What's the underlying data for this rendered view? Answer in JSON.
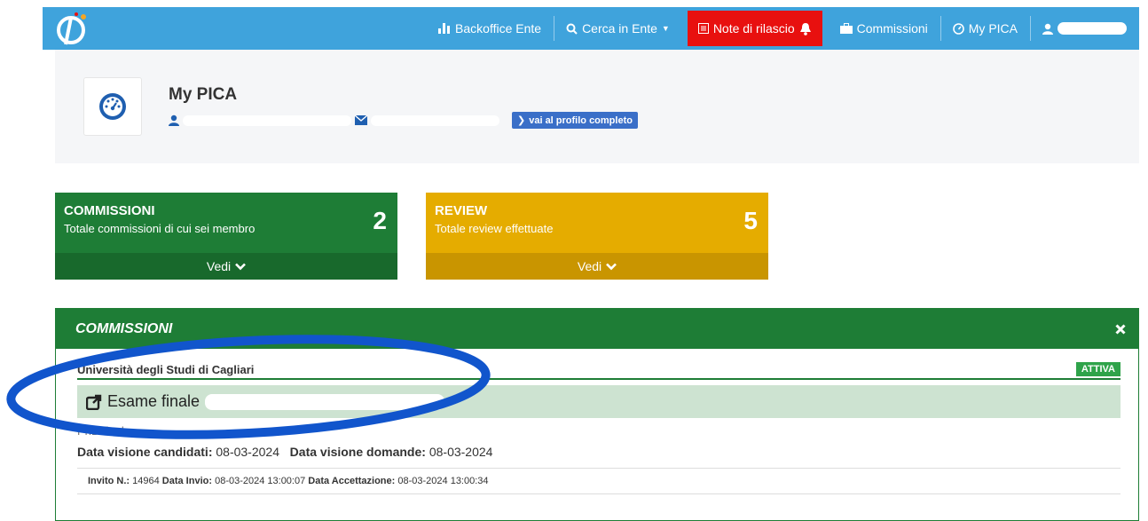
{
  "navbar": {
    "backoffice": "Backoffice Ente",
    "search": "Cerca in Ente",
    "release_notes": "Note di rilascio",
    "commissions": "Commissioni",
    "my_pica": "My PICA"
  },
  "profile": {
    "title": "My PICA",
    "full_profile_link": "vai al profilo completo"
  },
  "cards": [
    {
      "title": "COMMISSIONI",
      "subtitle": "Totale commissioni di cui sei membro",
      "count": "2",
      "action": "Vedi"
    },
    {
      "title": "REVIEW",
      "subtitle": "Totale review effettuate",
      "count": "5",
      "action": "Vedi"
    }
  ],
  "panel": {
    "title": "COMMISSIONI",
    "university": "Università degli Studi di Cagliari",
    "status": "ATTIVA",
    "exam_title": "Esame finale",
    "phd_line": "PhD final",
    "dates": {
      "candidates_label": "Data visione candidati:",
      "candidates_value": "08-03-2024",
      "applications_label": "Data visione domande:",
      "applications_value": "08-03-2024"
    },
    "invite": {
      "number_label": "Invito N.:",
      "number_value": "14964",
      "sent_label": "Data Invio:",
      "sent_value": "08-03-2024 13:00:07",
      "accepted_label": "Data Accettazione:",
      "accepted_value": "08-03-2024 13:00:34"
    }
  },
  "colors": {
    "navbar": "#3fa3dc",
    "release_notes": "#e8100f",
    "green": "#1e7d36",
    "yellow": "#e5ac00",
    "annotation": "#1155cc"
  }
}
